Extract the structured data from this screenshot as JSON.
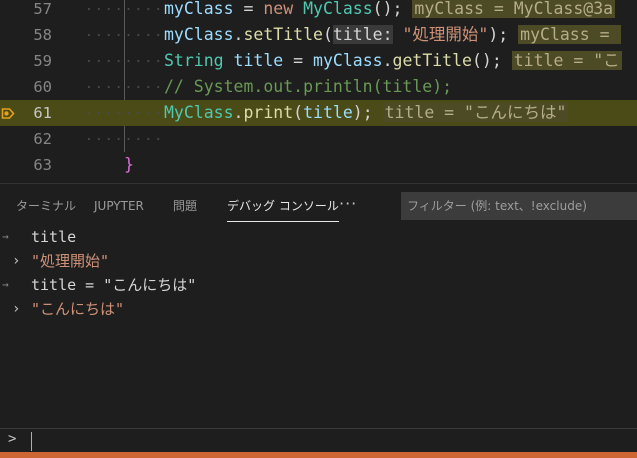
{
  "editor": {
    "lines": [
      {
        "num": "57",
        "tokens": [
          {
            "t": "myClass",
            "c": "var"
          },
          {
            "t": " = ",
            "c": "punc"
          },
          {
            "t": "new",
            "c": "kw2"
          },
          {
            "t": " ",
            "c": "punc"
          },
          {
            "t": "MyClass",
            "c": "cls"
          },
          {
            "t": "(); ",
            "c": "punc"
          },
          {
            "t": "myClass = MyClass@3a",
            "c": "hint"
          }
        ]
      },
      {
        "num": "58",
        "tokens": [
          {
            "t": "myClass",
            "c": "var"
          },
          {
            "t": ".",
            "c": "punc"
          },
          {
            "t": "setTitle",
            "c": "fn"
          },
          {
            "t": "(",
            "c": "punc"
          },
          {
            "t": "title:",
            "c": "param"
          },
          {
            "t": " ",
            "c": "punc"
          },
          {
            "t": "\"処理開始\"",
            "c": "str"
          },
          {
            "t": "); ",
            "c": "punc"
          },
          {
            "t": "myClass = ",
            "c": "hint"
          }
        ]
      },
      {
        "num": "59",
        "tokens": [
          {
            "t": "String",
            "c": "cls"
          },
          {
            "t": " ",
            "c": "punc"
          },
          {
            "t": "title",
            "c": "var"
          },
          {
            "t": " = ",
            "c": "punc"
          },
          {
            "t": "myClass",
            "c": "var"
          },
          {
            "t": ".",
            "c": "punc"
          },
          {
            "t": "getTitle",
            "c": "fn"
          },
          {
            "t": "(); ",
            "c": "punc"
          },
          {
            "t": "title = \"こ",
            "c": "hint"
          }
        ]
      },
      {
        "num": "60",
        "tokens": [
          {
            "t": "// System.out.println(title);",
            "c": "cmt"
          }
        ]
      },
      {
        "num": "61",
        "current": true,
        "tokens": [
          {
            "t": "MyClass",
            "c": "cls"
          },
          {
            "t": ".",
            "c": "punc"
          },
          {
            "t": "print",
            "c": "fn"
          },
          {
            "t": "(",
            "c": "punc"
          },
          {
            "t": "title",
            "c": "var"
          },
          {
            "t": "); ",
            "c": "punc"
          },
          {
            "t": "title = \"こんにちは\"",
            "c": "hint"
          }
        ]
      },
      {
        "num": "62",
        "tokens": []
      },
      {
        "num": "63",
        "brace": "}",
        "tokens": []
      }
    ]
  },
  "panel": {
    "tabs": [
      {
        "label": "ターミナル",
        "active": false
      },
      {
        "label": "JUPYTER",
        "active": false
      },
      {
        "label": "問題",
        "active": false
      },
      {
        "label": "デバッグ コンソール",
        "active": true
      }
    ],
    "more_label": "···",
    "filter_placeholder": "フィルター (例: text、!exclude)"
  },
  "console": {
    "entries": [
      {
        "kind": "input",
        "marker": "→",
        "text": "title",
        "color": "plain"
      },
      {
        "kind": "output",
        "marker": "›",
        "text": "\"処理開始\"",
        "color": "str"
      },
      {
        "kind": "input",
        "marker": "→",
        "text": "title = \"こんにちは\"",
        "color": "plain"
      },
      {
        "kind": "output",
        "marker": "›",
        "text": "\"こんにちは\"",
        "color": "str"
      }
    ],
    "prompt": ">"
  },
  "colors": {
    "current_line": "#4b4b18",
    "inline_hint_bg": "#4d4a26",
    "status_bar": "#cc6633",
    "breakpoint": "#e5a01f"
  }
}
